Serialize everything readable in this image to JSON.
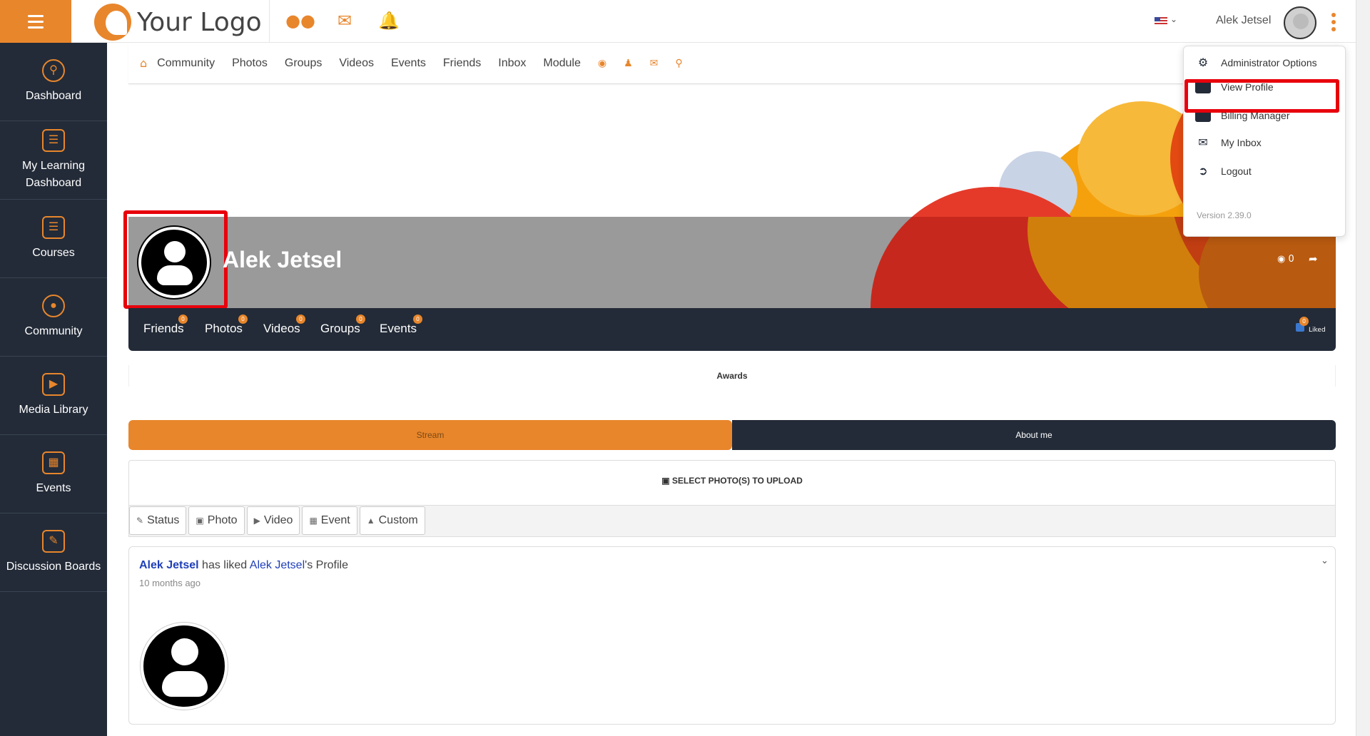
{
  "topbar": {
    "logo_text": "Your Logo",
    "icons": [
      "people-icon",
      "mail-icon",
      "bell-icon"
    ],
    "user_name": "Alek Jetsel"
  },
  "sidebar": {
    "items": [
      {
        "label": "Dashboard",
        "icon": "dashboard-icon"
      },
      {
        "label": "My Learning Dashboard",
        "icon": "book-icon"
      },
      {
        "label": "Courses",
        "icon": "book-icon"
      },
      {
        "label": "Community",
        "icon": "community-icon"
      },
      {
        "label": "Media Library",
        "icon": "media-icon"
      },
      {
        "label": "Events",
        "icon": "calendar-icon"
      },
      {
        "label": "Discussion Boards",
        "icon": "pen-icon"
      }
    ]
  },
  "subnav": {
    "links": [
      "Community",
      "Photos",
      "Groups",
      "Videos",
      "Events",
      "Friends",
      "Inbox",
      "Module"
    ]
  },
  "profile": {
    "name": "Alek Jetsel",
    "views": "0",
    "tabs": [
      {
        "label": "Friends",
        "count": "0"
      },
      {
        "label": "Photos",
        "count": "0"
      },
      {
        "label": "Videos",
        "count": "0"
      },
      {
        "label": "Groups",
        "count": "0"
      },
      {
        "label": "Events",
        "count": "0"
      }
    ],
    "liked_count": "0",
    "liked_label": "Liked",
    "awards": "Awards"
  },
  "segment": {
    "stream": "Stream",
    "about": "About me"
  },
  "upload": {
    "label": "SELECT PHOTO(S) TO UPLOAD"
  },
  "post_types": [
    "Status",
    "Photo",
    "Video",
    "Event",
    "Custom"
  ],
  "feed": {
    "actor": "Alek Jetsel",
    "action": " has liked ",
    "target": "Alek Jetsel",
    "suffix": "'s Profile",
    "time": "10 months ago"
  },
  "dropdown": {
    "items": [
      "Administrator Options",
      "View Profile",
      "Billing Manager",
      "My Inbox",
      "Logout"
    ],
    "version": "Version 2.39.0"
  },
  "colors": {
    "accent": "#e8862c",
    "dark": "#232b38",
    "highlight": "#e8000c",
    "link": "#1f3fb8"
  }
}
